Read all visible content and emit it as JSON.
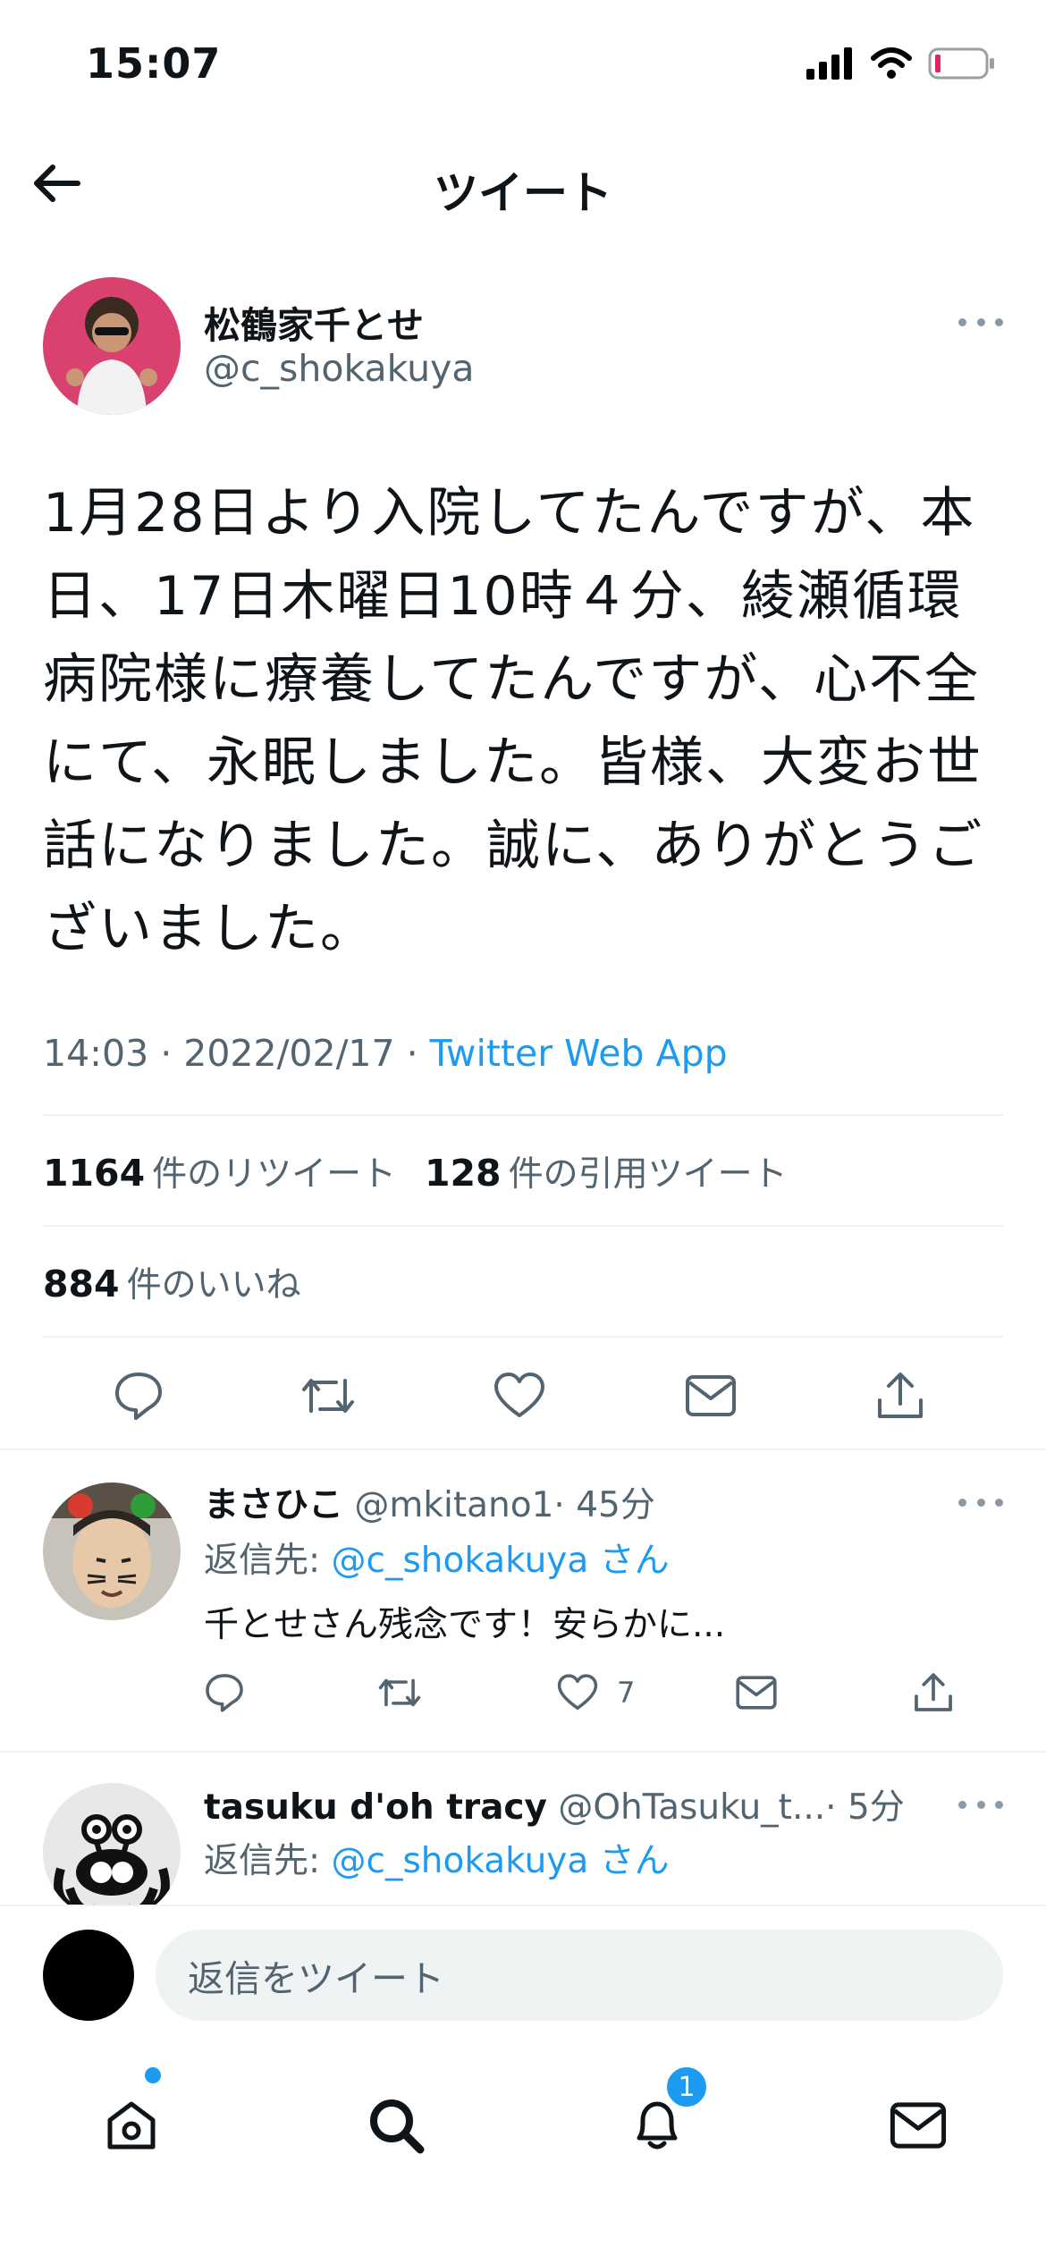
{
  "status_bar": {
    "time": "15:07"
  },
  "header": {
    "title": "ツイート"
  },
  "tweet": {
    "author_name": "松鶴家千とせ",
    "author_handle": "@c_shokakuya",
    "text": "1月28日より入院してたんですが、本日、17日木曜日10時４分、綾瀬循環病院様に療養してたんですが、心不全にて、永眠しました。皆様、大変お世話になりました。誠に、ありがとうございました。",
    "timestamp": "14:03 · 2022/02/17 · ",
    "source": "Twitter Web App",
    "retweets_count": "1164",
    "retweets_label": "件のリツイート",
    "quotes_count": "128",
    "quotes_label": "件の引用ツイート",
    "likes_count": "884",
    "likes_label": "件のいいね"
  },
  "replies": [
    {
      "name": "まさひこ",
      "handle": "@mkitano1",
      "time": "· 45分",
      "reply_to_prefix": "返信先: ",
      "reply_to_handle": "@c_shokakuya さん",
      "text": "千とせさん残念です！安らかに...",
      "like_count": "7"
    },
    {
      "name": "tasuku d'oh tracy",
      "handle": "@OhTasuku_t...",
      "time": "· 5分",
      "reply_to_prefix": "返信先: ",
      "reply_to_handle": "@c_shokakuya さん"
    }
  ],
  "compose": {
    "placeholder": "返信をツイート"
  },
  "tab_bar": {
    "notifications_badge": "1"
  },
  "colors": {
    "accent": "#1d9bf0",
    "text": "#0f1419",
    "muted": "#536471",
    "divider": "#eff3f4"
  }
}
